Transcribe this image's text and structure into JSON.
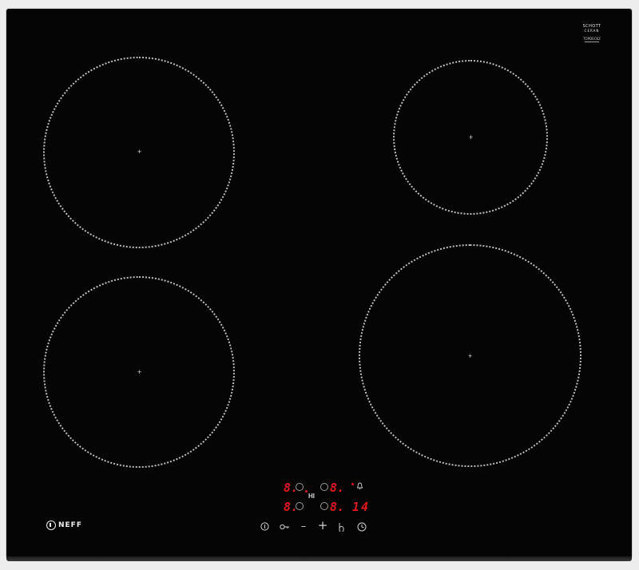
{
  "product": {
    "brand": "NEFF",
    "glass_brand_line1": "SCHOTT",
    "glass_brand_line2": "CERAN",
    "glass_brand_line3": "TOPDECKZ"
  },
  "zones": [
    {
      "id": "rear-left",
      "name": "zone-rear-left"
    },
    {
      "id": "front-left",
      "name": "zone-front-left"
    },
    {
      "id": "rear-right",
      "name": "zone-rear-right"
    },
    {
      "id": "front-right",
      "name": "zone-front-right"
    }
  ],
  "display": {
    "rear_left_level": "8.",
    "rear_right_level": "8.",
    "front_left_level": "8.",
    "front_right_level": "8.",
    "boost_label": "HI",
    "timer_value": "14",
    "segment_color": "#e0191e"
  },
  "controls": {
    "power_icon": "power-icon",
    "lock_icon": "childlock-icon",
    "minus_icon": "minus-icon",
    "plus_icon": "plus-icon",
    "hand_icon": "wipe-protect-icon",
    "timer_icon": "timer-icon",
    "minus_label": "–",
    "plus_label": "+"
  }
}
